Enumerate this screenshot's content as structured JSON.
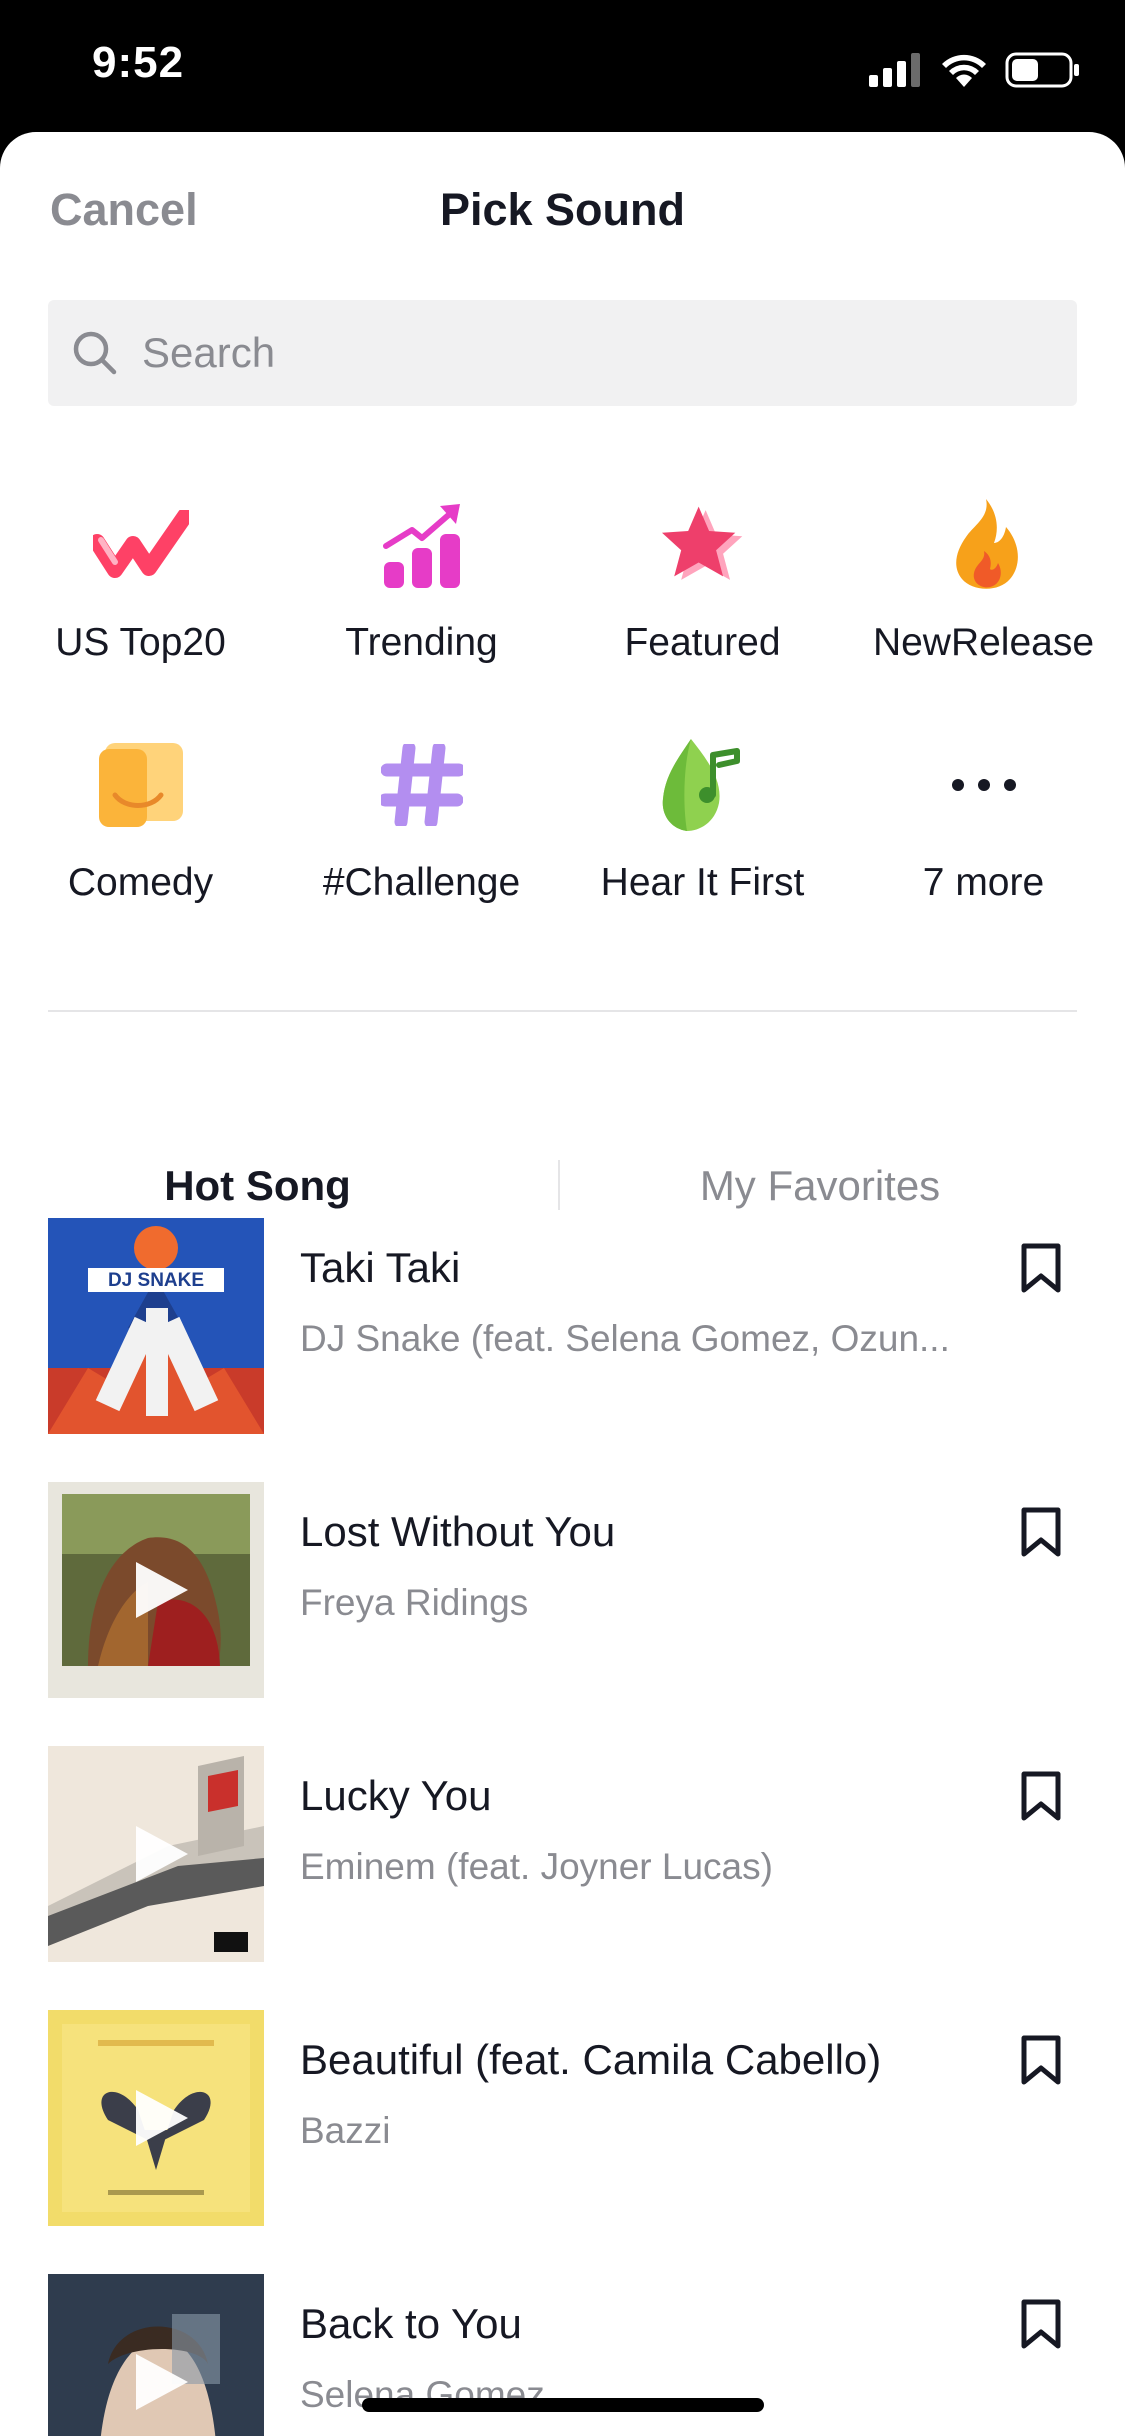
{
  "status": {
    "time": "9:52"
  },
  "header": {
    "cancel_label": "Cancel",
    "title": "Pick Sound"
  },
  "search": {
    "placeholder": "Search",
    "value": ""
  },
  "categories": [
    {
      "label": "US Top20",
      "icon": "us-top20-icon",
      "color": "#fe2c55"
    },
    {
      "label": "Trending",
      "icon": "trending-icon",
      "color": "#e63cc7"
    },
    {
      "label": "Featured",
      "icon": "featured-star-icon",
      "color": "#ee3f6b"
    },
    {
      "label": "NewRelease",
      "icon": "fire-icon",
      "color": "#f7a11a"
    },
    {
      "label": "Comedy",
      "icon": "comedy-icon",
      "color": "#fbb43a"
    },
    {
      "label": "#Challenge",
      "icon": "hashtag-icon",
      "color": "#b38ef0"
    },
    {
      "label": "Hear It First",
      "icon": "leaf-music-icon",
      "color": "#8fd14f"
    },
    {
      "label": "7 more",
      "icon": "more-dots-icon",
      "color": "#161823"
    }
  ],
  "tabs": {
    "hot_song": "Hot Song",
    "my_favorites": "My Favorites"
  },
  "songs": [
    {
      "title": "Taki Taki",
      "artist": "DJ Snake (feat. Selena Gomez, Ozun...",
      "cover_text": "DJ SNAKE"
    },
    {
      "title": "Lost Without You",
      "artist": "Freya Ridings"
    },
    {
      "title": "Lucky You",
      "artist": "Eminem (feat. Joyner Lucas)"
    },
    {
      "title": "Beautiful (feat. Camila Cabello)",
      "artist": "Bazzi"
    },
    {
      "title": "Back to You",
      "artist": "Selena Gomez"
    }
  ]
}
